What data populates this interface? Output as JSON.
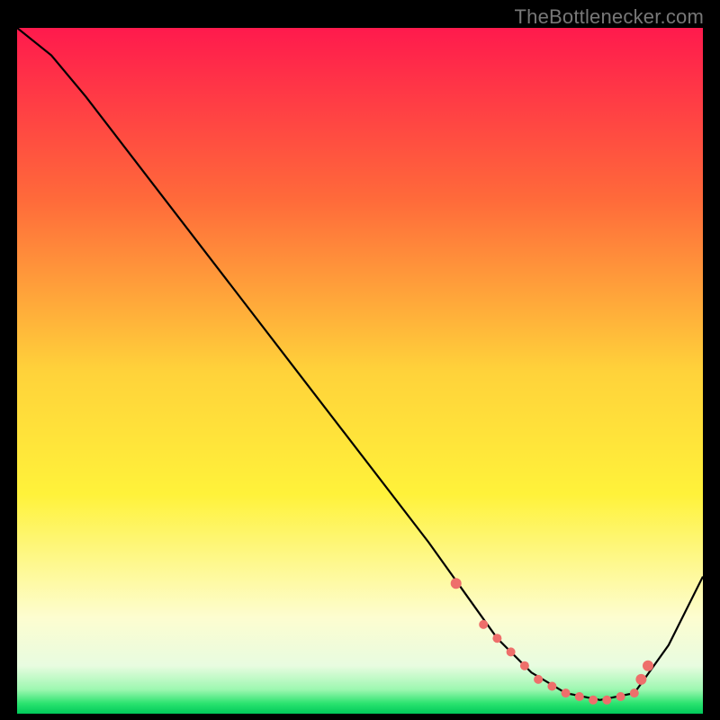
{
  "attribution": "TheBottlenecker.com",
  "chart_data": {
    "type": "line",
    "title": "",
    "xlabel": "",
    "ylabel": "",
    "xlim": [
      0,
      100
    ],
    "ylim": [
      0,
      100
    ],
    "series": [
      {
        "name": "curve",
        "x": [
          0,
          5,
          10,
          20,
          30,
          40,
          50,
          60,
          65,
          70,
          75,
          80,
          85,
          90,
          95,
          100
        ],
        "values": [
          100,
          96,
          90,
          77,
          64,
          51,
          38,
          25,
          18,
          11,
          6,
          3,
          2,
          3,
          10,
          20
        ]
      }
    ],
    "markers": {
      "x": [
        64,
        68,
        70,
        72,
        74,
        76,
        78,
        80,
        82,
        84,
        86,
        88,
        90,
        91,
        92
      ],
      "values": [
        19,
        13,
        11,
        9,
        7,
        5,
        4,
        3,
        2.5,
        2,
        2,
        2.5,
        3,
        5,
        7
      ]
    },
    "background": {
      "top_color": "#ff1a4d",
      "stops": [
        {
          "offset": 0,
          "color": "#ff1a4d"
        },
        {
          "offset": 0.25,
          "color": "#ff6a3a"
        },
        {
          "offset": 0.5,
          "color": "#ffd23a"
        },
        {
          "offset": 0.68,
          "color": "#fff23a"
        },
        {
          "offset": 0.86,
          "color": "#fdfdd0"
        },
        {
          "offset": 0.93,
          "color": "#e8fce0"
        },
        {
          "offset": 0.965,
          "color": "#9cf7b0"
        },
        {
          "offset": 0.985,
          "color": "#2be36f"
        },
        {
          "offset": 1,
          "color": "#00c95a"
        }
      ]
    },
    "curve_color": "#000000",
    "marker_color": "#ee6f6b"
  }
}
